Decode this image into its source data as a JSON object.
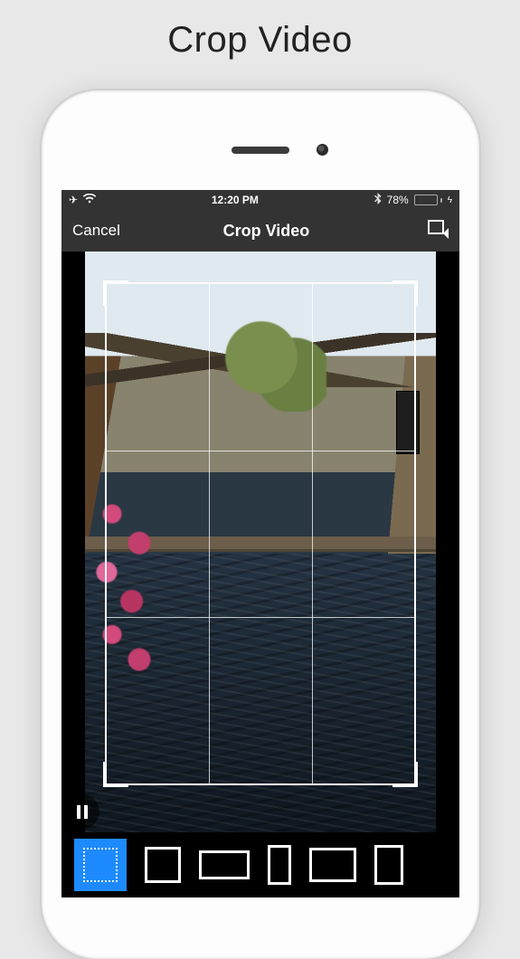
{
  "promo": {
    "title": "Crop Video"
  },
  "statusbar": {
    "time": "12:20 PM",
    "battery_pct": "78%",
    "icons": {
      "airplane": "✈",
      "wifi": "wifi",
      "bluetooth": "bluetooth",
      "bolt": "⚡"
    }
  },
  "nav": {
    "cancel": "Cancel",
    "title": "Crop Video",
    "done_icon": "crop-confirm"
  },
  "playback": {
    "state": "paused"
  },
  "aspect_ratios": [
    {
      "id": "free",
      "label": "Free",
      "selected": true
    },
    {
      "id": "1:1",
      "label": "1:1",
      "selected": false
    },
    {
      "id": "16:9",
      "label": "16:9",
      "selected": false
    },
    {
      "id": "9:16",
      "label": "9:16",
      "selected": false
    },
    {
      "id": "4:3",
      "label": "4:3",
      "selected": false
    },
    {
      "id": "3:4",
      "label": "3:4",
      "selected": false
    }
  ]
}
